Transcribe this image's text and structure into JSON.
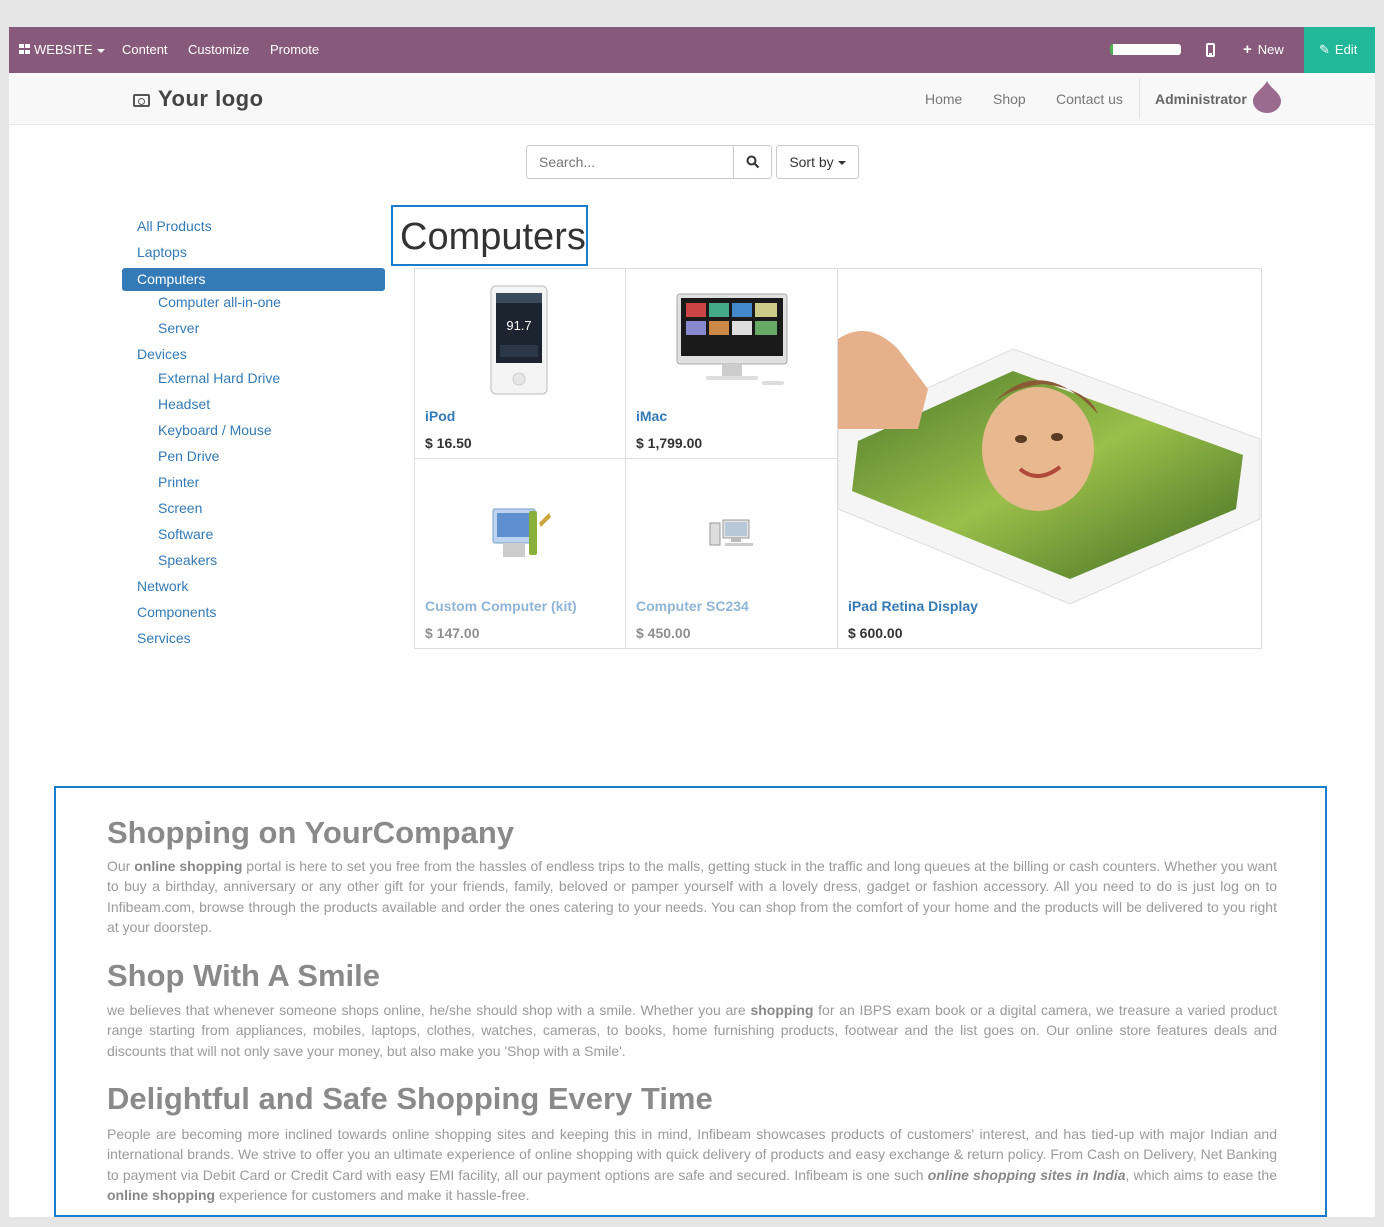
{
  "adminbar": {
    "website_label": "WEBSITE",
    "content_label": "Content",
    "customize_label": "Customize",
    "promote_label": "Promote",
    "new_label": "New",
    "edit_label": "Edit"
  },
  "header": {
    "logo_text": "Your logo",
    "nav": [
      "Home",
      "Shop",
      "Contact us"
    ],
    "user": "Administrator"
  },
  "search": {
    "placeholder": "Search...",
    "sort_label": "Sort by"
  },
  "categories": [
    "All Products",
    "Laptops",
    "Computers",
    "Computer all-in-one",
    "Server",
    "Devices",
    "External Hard Drive",
    "Headset",
    "Keyboard / Mouse",
    "Pen Drive",
    "Printer",
    "Screen",
    "Software",
    "Speakers",
    "Network",
    "Components",
    "Services"
  ],
  "page_title": "Computers",
  "products": [
    {
      "name": "iPod",
      "price": "$ 16.50"
    },
    {
      "name": "iMac",
      "price": "$ 1,799.00"
    },
    {
      "name": "Custom Computer (kit)",
      "price": "$ 147.00"
    },
    {
      "name": "Computer SC234",
      "price": "$ 450.00"
    },
    {
      "name": "iPad Retina Display",
      "price": "$ 600.00"
    }
  ],
  "seo": {
    "h1": "Shopping on YourCompany",
    "p1_a": "Our ",
    "p1_b": "online shopping",
    "p1_c": " portal is here to set you free from the hassles of endless trips to the malls, getting stuck in the traffic and long queues at the billing or cash counters. Whether you want to buy a birthday, anniversary or any other gift for your friends, family, beloved or pamper yourself with a lovely dress, gadget or fashion accessory. All you need to do is just log on to Infibeam.com, browse through the products available and order the ones catering to your needs. You can shop from the comfort of your home and the products will be delivered to you right at your doorstep.",
    "h2": "Shop With A Smile",
    "p2_a": "we believes that whenever someone shops online, he/she should shop with a smile. Whether you are ",
    "p2_b": "shopping",
    "p2_c": " for an IBPS exam book or a digital camera, we treasure a varied product range starting from appliances, mobiles, laptops, clothes, watches, cameras, to books, home furnishing products, footwear and the list goes on. Our online store features deals and discounts that will not only save your money, but also make you 'Shop with a Smile'.",
    "h3": "Delightful and Safe Shopping Every Time",
    "p3_a": "People are becoming more inclined towards online shopping sites and keeping this in mind, Infibeam showcases products of customers' interest, and has tied-up with major Indian and international brands. We strive to offer you an ultimate experience of online shopping with quick delivery of products and easy exchange & return policy. From Cash on Delivery, Net Banking to payment via Debit Card or Credit Card with easy EMI facility, all our payment options are safe and secured. Infibeam is one such ",
    "p3_b": "online shopping sites in India",
    "p3_c": ", which aims to ease the ",
    "p3_d": "online shopping",
    "p3_e": " experience for customers and make it hassle-free."
  }
}
